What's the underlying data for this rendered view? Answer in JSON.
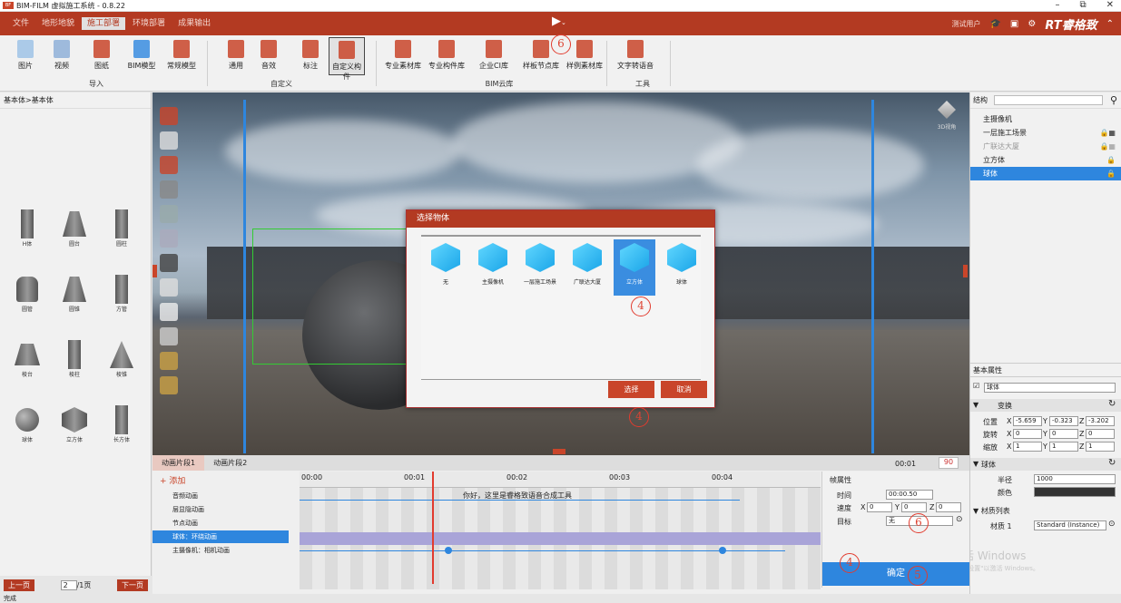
{
  "app": {
    "title": "BIM-FILM 虚拟施工系统 - 0.8.22",
    "user": "测试用户",
    "brand": "RT睿格致"
  },
  "menu": [
    "文件",
    "地形地貌",
    "施工部署",
    "环境部署",
    "成果输出"
  ],
  "ribbon": {
    "buttons": [
      "图片",
      "视频",
      "图纸",
      "BIM模型",
      "常规模型",
      "通用",
      "音效",
      "标注",
      "自定义构件",
      "专业素材库",
      "专业构件库",
      "企业CI库",
      "样板节点库",
      "样例素材库",
      "文字转语音"
    ],
    "groups": [
      "导入",
      "自定义",
      "BIM云库",
      "工具"
    ],
    "selected": "自定义构件"
  },
  "left": {
    "breadcrumb": "基本体>基本体",
    "shapes": [
      "H体",
      "圆台",
      "圆柱",
      "圆管",
      "圆锥",
      "方管",
      "棱台",
      "棱柱",
      "棱锥",
      "球体",
      "立方体",
      "长方体"
    ],
    "pager": {
      "prev": "上一页",
      "page": "2",
      "total": "/1页",
      "next": "下一页"
    }
  },
  "dialog": {
    "title": "选择物体",
    "objects": [
      "无",
      "主摄像机",
      "一层施工场景",
      "广联达大厦",
      "立方体",
      "球体"
    ],
    "selected": "立方体",
    "ok": "选择",
    "cancel": "取消"
  },
  "viewcube": "3D视角",
  "annotations": {
    "a1": "4",
    "a2": "4",
    "a3": "4",
    "a4": "6",
    "a5": "5",
    "a6": "6"
  },
  "right": {
    "search_label": "结构",
    "tree": [
      {
        "label": "主摄像机"
      },
      {
        "label": "一层施工场景"
      },
      {
        "label": "广联达大厦",
        "dim": true
      },
      {
        "label": "立方体"
      },
      {
        "label": "球体",
        "sel": true
      }
    ],
    "basic_props": "基本属性",
    "name": "球体",
    "transform": "变换",
    "pos": {
      "label": "位置",
      "x": "-5.659",
      "y": "-0.323",
      "z": "-3.202"
    },
    "rot": {
      "label": "旋转",
      "x": "0",
      "y": "0",
      "z": "0"
    },
    "scale": {
      "label": "缩放",
      "x": "1",
      "y": "1",
      "z": "1"
    },
    "sphere": "球体",
    "radius_label": "半径",
    "radius": "1000",
    "color_label": "颜色",
    "mat_list": "材质列表",
    "mat_label": "材质 1",
    "mat_value": "Standard (Instance)",
    "watermark": "激活 Windows",
    "watermark2": "转到\"设置\"以激活 Windows。"
  },
  "timeline": {
    "tabs": [
      "动画片段1",
      "动画片段2"
    ],
    "time": "00:01",
    "fps": "90",
    "add": "+ 添加",
    "tracks": [
      "音频动画",
      "层显隐动画",
      "节点动画",
      "球体：环绕动画",
      "主摄像机：相机动画"
    ],
    "ticks": [
      "00:00",
      "00:01",
      "00:02",
      "00:03",
      "00:04"
    ],
    "caption": "你好，这里是睿格致语音合成工具",
    "frame": {
      "title": "帧属性",
      "time_label": "时间",
      "time": "00:00.50",
      "speed_label": "速度",
      "sx": "0",
      "sy": "0",
      "sz": "0",
      "target_label": "目标",
      "target": "无",
      "confirm": "确定"
    }
  },
  "status": "完成"
}
